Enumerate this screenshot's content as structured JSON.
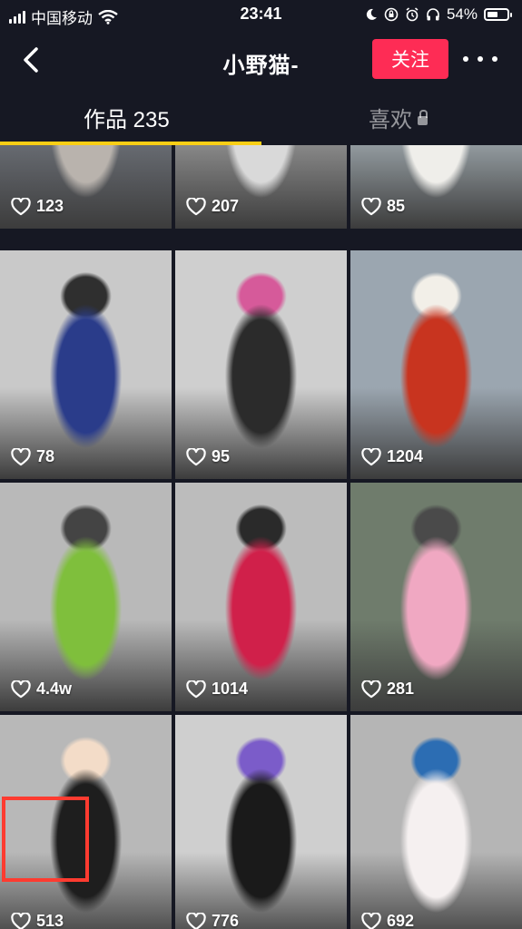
{
  "status_bar": {
    "carrier": "中国移动",
    "time": "23:41",
    "battery": "54%",
    "battery_level": 0.54
  },
  "nav": {
    "back_icon": "chevron-left-icon",
    "title": "小野猫-",
    "follow_label": "关注",
    "more_icon": "more-dots-icon"
  },
  "tabs": [
    {
      "label": "作品 235",
      "active": true
    },
    {
      "label": "喜欢",
      "locked": true
    }
  ],
  "colors": {
    "accent": "#fe2c55",
    "tab_indicator": "#face15",
    "background": "#161823",
    "highlight": "#ff3b30"
  },
  "grid": {
    "items": [
      {
        "likes": "123",
        "palette": [
          "#6b6f76",
          "#b9b3ad",
          "#2a2a2a"
        ]
      },
      {
        "likes": "207",
        "palette": [
          "#8f8f8f",
          "#d9d9d9",
          "#1e1e1e"
        ]
      },
      {
        "likes": "85",
        "palette": [
          "#9aa3a8",
          "#efeeea",
          "#c8b9a0"
        ]
      },
      {
        "likes": "78",
        "palette": [
          "#c9c9c9",
          "#2a3c8a",
          "#2f2f2f"
        ]
      },
      {
        "likes": "95",
        "palette": [
          "#cfcfcf",
          "#2b2b2b",
          "#d65a9a"
        ]
      },
      {
        "likes": "1204",
        "palette": [
          "#9ba6b0",
          "#c8341f",
          "#f2efe8"
        ]
      },
      {
        "likes": "4.4w",
        "palette": [
          "#b9b9b9",
          "#7fbf3c",
          "#444444"
        ]
      },
      {
        "likes": "1014",
        "palette": [
          "#bcbcbc",
          "#d0204a",
          "#2a2a2a"
        ]
      },
      {
        "likes": "281",
        "palette": [
          "#6f7c6c",
          "#f0a8c2",
          "#4a4a4a"
        ]
      },
      {
        "likes": "513",
        "palette": [
          "#b8b8b8",
          "#1e1e1e",
          "#f3dcc8"
        ]
      },
      {
        "likes": "776",
        "palette": [
          "#cfcfcf",
          "#1a1a1a",
          "#7b5cc9"
        ]
      },
      {
        "likes": "692",
        "palette": [
          "#b5b5b5",
          "#f5f0f0",
          "#2c6db3"
        ]
      }
    ]
  }
}
